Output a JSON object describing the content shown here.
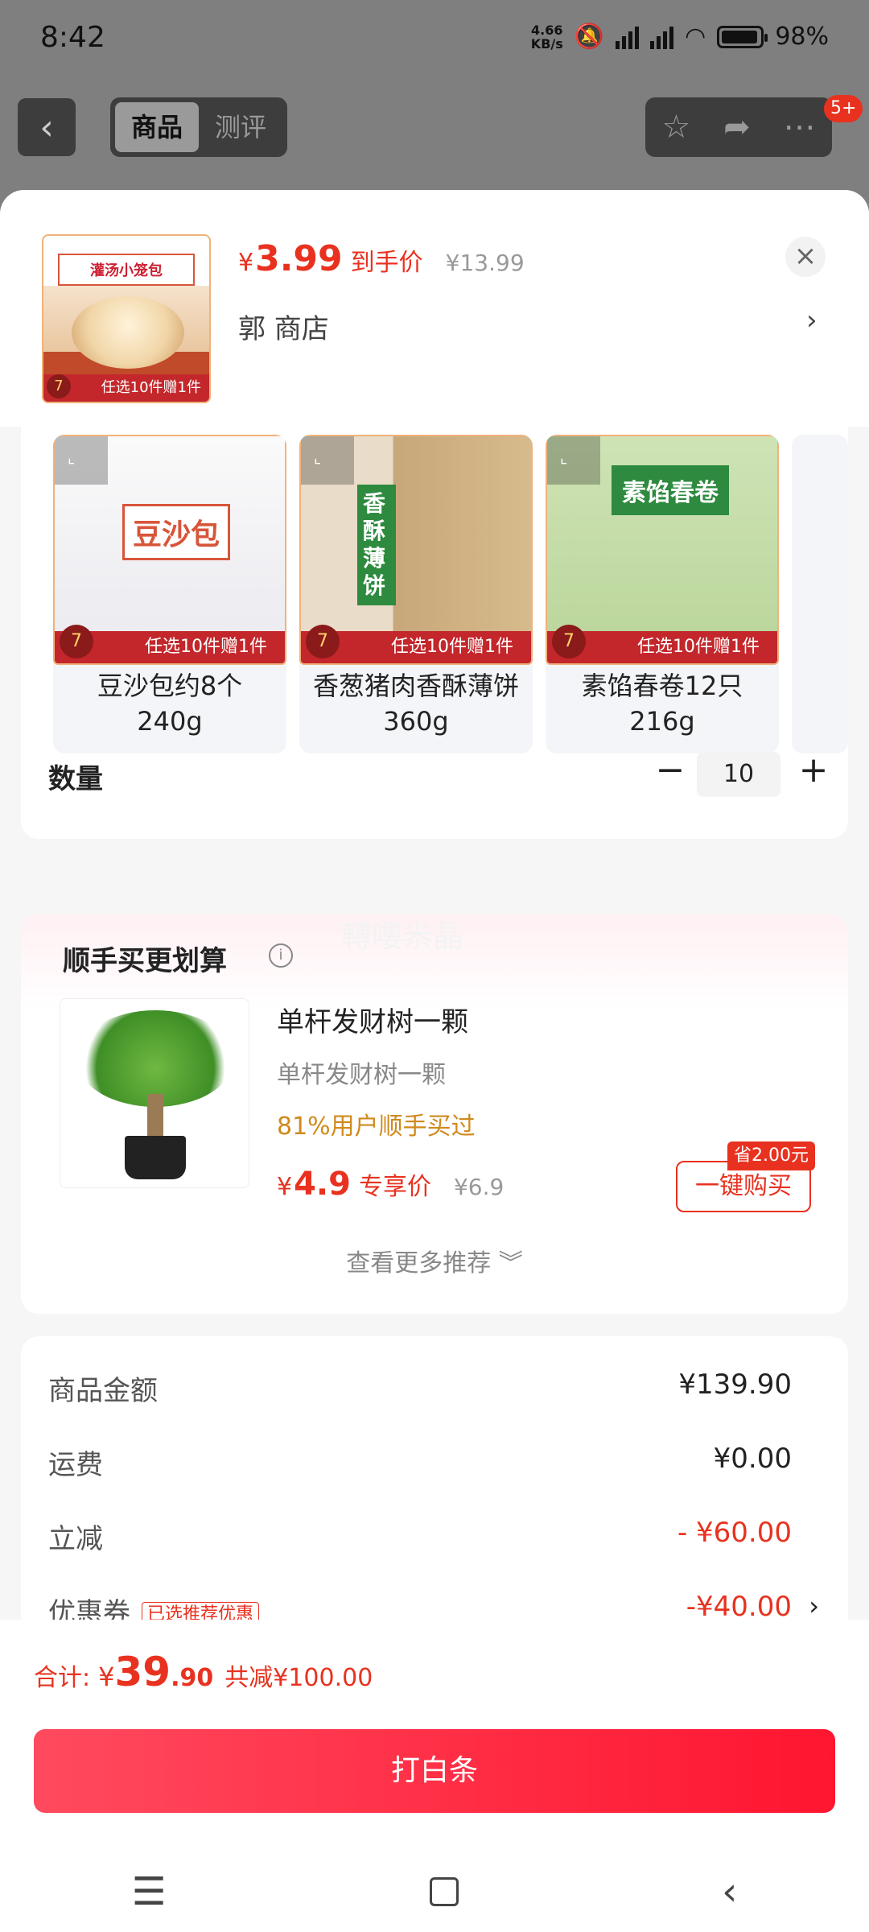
{
  "status_bar": {
    "time": "8:42",
    "net_speed_top": "4.66",
    "net_speed_bottom": "KB/s",
    "battery": "98%"
  },
  "header": {
    "tabs": [
      "商品",
      "测评"
    ],
    "active_tab": "商品",
    "badge": "5+"
  },
  "product": {
    "price_currency": "¥",
    "price_main": "3.99",
    "price_label": "到手价",
    "original_price": "¥13.99",
    "shop": "郭  商店",
    "thumb_title": "灌汤小笼包",
    "thumb_promo": "任选10件赠1件",
    "thumb_num": "7"
  },
  "variants": [
    {
      "image_label": "豆沙包",
      "name_line1": "豆沙包约8个",
      "name_line2": "240g",
      "promo": "任选10件赠1件",
      "num": "7"
    },
    {
      "image_label": "香酥薄饼",
      "name_line1": "香葱猪肉香酥薄饼",
      "name_line2": "360g",
      "promo": "任选10件赠1件",
      "num": "7"
    },
    {
      "image_label": "素馅春卷",
      "name_line1": "素馅春卷12只",
      "name_line2": "216g",
      "promo": "任选10件赠1件",
      "num": "7"
    }
  ],
  "quantity": {
    "label": "数量",
    "value": "10"
  },
  "addon": {
    "watermark": "轉嘍尜晶",
    "title": "顺手买更划算",
    "name": "单杆发财树一颗",
    "subtitle": "单杆发财树一颗",
    "pct_text": "81%用户顺手买过",
    "price_currency": "¥",
    "price_main": "4.9",
    "price_label": "专享价",
    "original_price": "¥6.9",
    "save_tag": "省2.00元",
    "buy_button": "一键购买",
    "more": "查看更多推荐 ︾"
  },
  "summary": {
    "rows": [
      {
        "label": "商品金额",
        "value": "¥139.90"
      },
      {
        "label": "运费",
        "value": "¥0.00"
      },
      {
        "label": "立减",
        "value": "- ¥60.00"
      },
      {
        "label": "优惠券",
        "value": "-¥40.00",
        "tag": "已选推荐优惠"
      }
    ]
  },
  "footer": {
    "total_label": "合计:",
    "currency": "¥",
    "total_int": "39",
    "total_dec": ".90",
    "saved": "共减¥100.00",
    "pay_button": "打白条"
  },
  "colors": {
    "accent": "#e8321f",
    "pay_button": "#ff1530",
    "discount_text": "#d08a1c"
  }
}
